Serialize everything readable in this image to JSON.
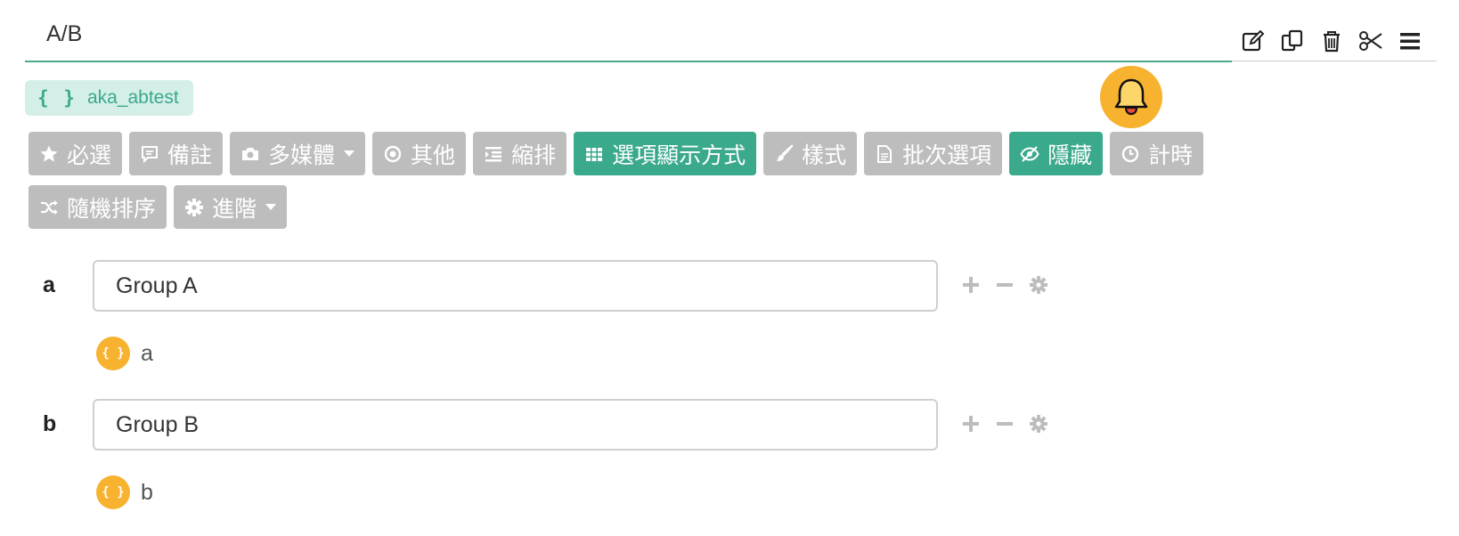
{
  "question": {
    "title": "A/B",
    "variable_tag": "aka_abtest",
    "variable_brace": "{ }"
  },
  "toolbar": {
    "icons": [
      "edit-icon",
      "copy-icon",
      "trash-icon",
      "scissors-icon",
      "menu-icon"
    ]
  },
  "settings_buttons": {
    "row1": [
      {
        "label": "必選",
        "icon": "star-icon",
        "active": false,
        "dropdown": false
      },
      {
        "label": "備註",
        "icon": "comment-icon",
        "active": false,
        "dropdown": false
      },
      {
        "label": "多媒體",
        "icon": "camera-icon",
        "active": false,
        "dropdown": true
      },
      {
        "label": "其他",
        "icon": "dot-circle-icon",
        "active": false,
        "dropdown": false
      },
      {
        "label": "縮排",
        "icon": "indent-icon",
        "active": false,
        "dropdown": false
      },
      {
        "label": "選項顯示方式",
        "icon": "grid-icon",
        "active": true,
        "dropdown": false
      },
      {
        "label": "樣式",
        "icon": "brush-icon",
        "active": false,
        "dropdown": false
      },
      {
        "label": "批次選項",
        "icon": "file-icon",
        "active": false,
        "dropdown": false
      },
      {
        "label": "隱藏",
        "icon": "eye-slash-icon",
        "active": true,
        "dropdown": false
      },
      {
        "label": "計時",
        "icon": "clock-icon",
        "active": false,
        "dropdown": false
      }
    ],
    "row2": [
      {
        "label": "隨機排序",
        "icon": "shuffle-icon",
        "active": false,
        "dropdown": false
      },
      {
        "label": "進階",
        "icon": "cog-icon",
        "active": false,
        "dropdown": true
      }
    ]
  },
  "options": [
    {
      "label": "a",
      "value": "Group A",
      "variable": "a"
    },
    {
      "label": "b",
      "value": "Group B",
      "variable": "b"
    }
  ],
  "colors": {
    "accent": "#3aa98c",
    "button_gray": "#bdbdbd",
    "bell": "#f7b22f",
    "tag_bg": "#d4efe8"
  }
}
